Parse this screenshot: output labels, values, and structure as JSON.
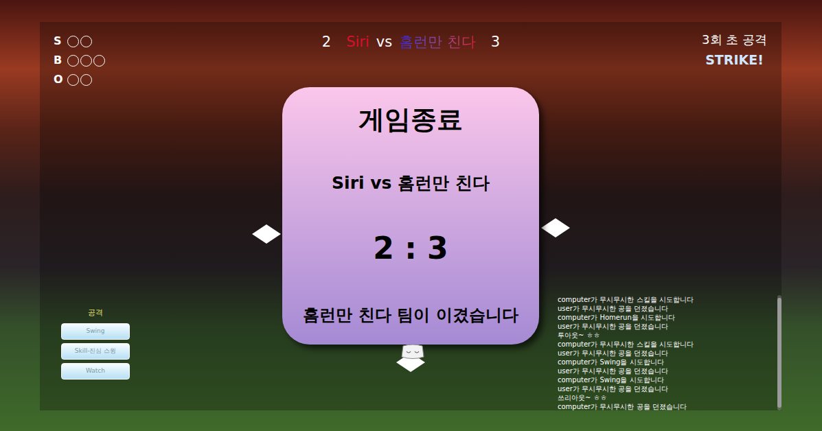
{
  "count": [
    {
      "label": "S",
      "lights": [
        {
          "on": false
        },
        {
          "on": false
        }
      ]
    },
    {
      "label": "B",
      "lights": [
        {
          "on": false
        },
        {
          "on": false
        },
        {
          "on": false
        }
      ]
    },
    {
      "label": "O",
      "lights": [
        {
          "on": false
        },
        {
          "on": false
        }
      ]
    }
  ],
  "scoreboard": {
    "away_score": "2",
    "away": "Siri",
    "vs": "vs",
    "home": "홈런만 친다",
    "home_score": "3"
  },
  "inning": "3회 초 공격",
  "call": "STRIKE!",
  "modal": {
    "title": "게임종료",
    "matchup": "Siri vs 홈런만 친다",
    "score": "2 : 3",
    "result": "홈런만 친다 팀이 이겼습니다"
  },
  "controls": {
    "label": "공격",
    "buttons": [
      "Swing",
      "Skill-진심 스윙",
      "Watch"
    ]
  },
  "log": [
    "computer가 무시무시한 스킬을 시도합니다",
    "user가 무시무시한 공을 던졌습니다",
    "computer가 Homerun을 시도합니다",
    "user가 무시무시한 공을 던졌습니다",
    "투아웃~ ㅎㅎ",
    "computer가 무시무시한 스킬을 시도합니다",
    "user가 무시무시한 공을 던졌습니다",
    "computer가 Swing을 시도합니다",
    "user가 무시무시한 공을 던졌습니다",
    "computer가 Swing을 시도합니다",
    "user가 무시무시한 공을 던졌습니다",
    "쓰리아웃~ ㅎㅎ",
    "computer가 무시무시한 공을 던졌습니다"
  ]
}
